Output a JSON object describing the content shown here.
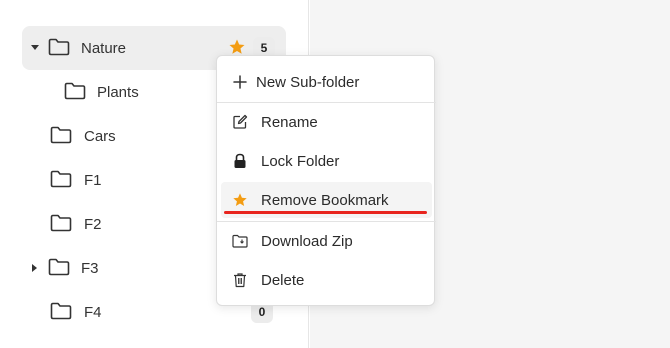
{
  "colors": {
    "star": "#f39c12",
    "annotation_underline": "#e8251f",
    "selected_row_bg": "#eeeeee"
  },
  "tree": {
    "items": [
      {
        "label": "Nature",
        "expanded": true,
        "has_children": true,
        "bookmarked": true,
        "count": "5",
        "selected": true
      },
      {
        "label": "Plants"
      },
      {
        "label": "Cars"
      },
      {
        "label": "F1"
      },
      {
        "label": "F2"
      },
      {
        "label": "F3",
        "has_children": true
      },
      {
        "label": "F4",
        "count": "0"
      }
    ]
  },
  "context_menu": {
    "items": [
      {
        "label": "New Sub-folder",
        "icon": "plus-icon"
      },
      {
        "label": "Rename",
        "icon": "edit-icon"
      },
      {
        "label": "Lock Folder",
        "icon": "lock-icon"
      },
      {
        "label": "Remove Bookmark",
        "icon": "star-icon",
        "highlighted": true
      },
      {
        "label": "Download Zip",
        "icon": "download-folder-icon"
      },
      {
        "label": "Delete",
        "icon": "trash-icon"
      }
    ]
  }
}
